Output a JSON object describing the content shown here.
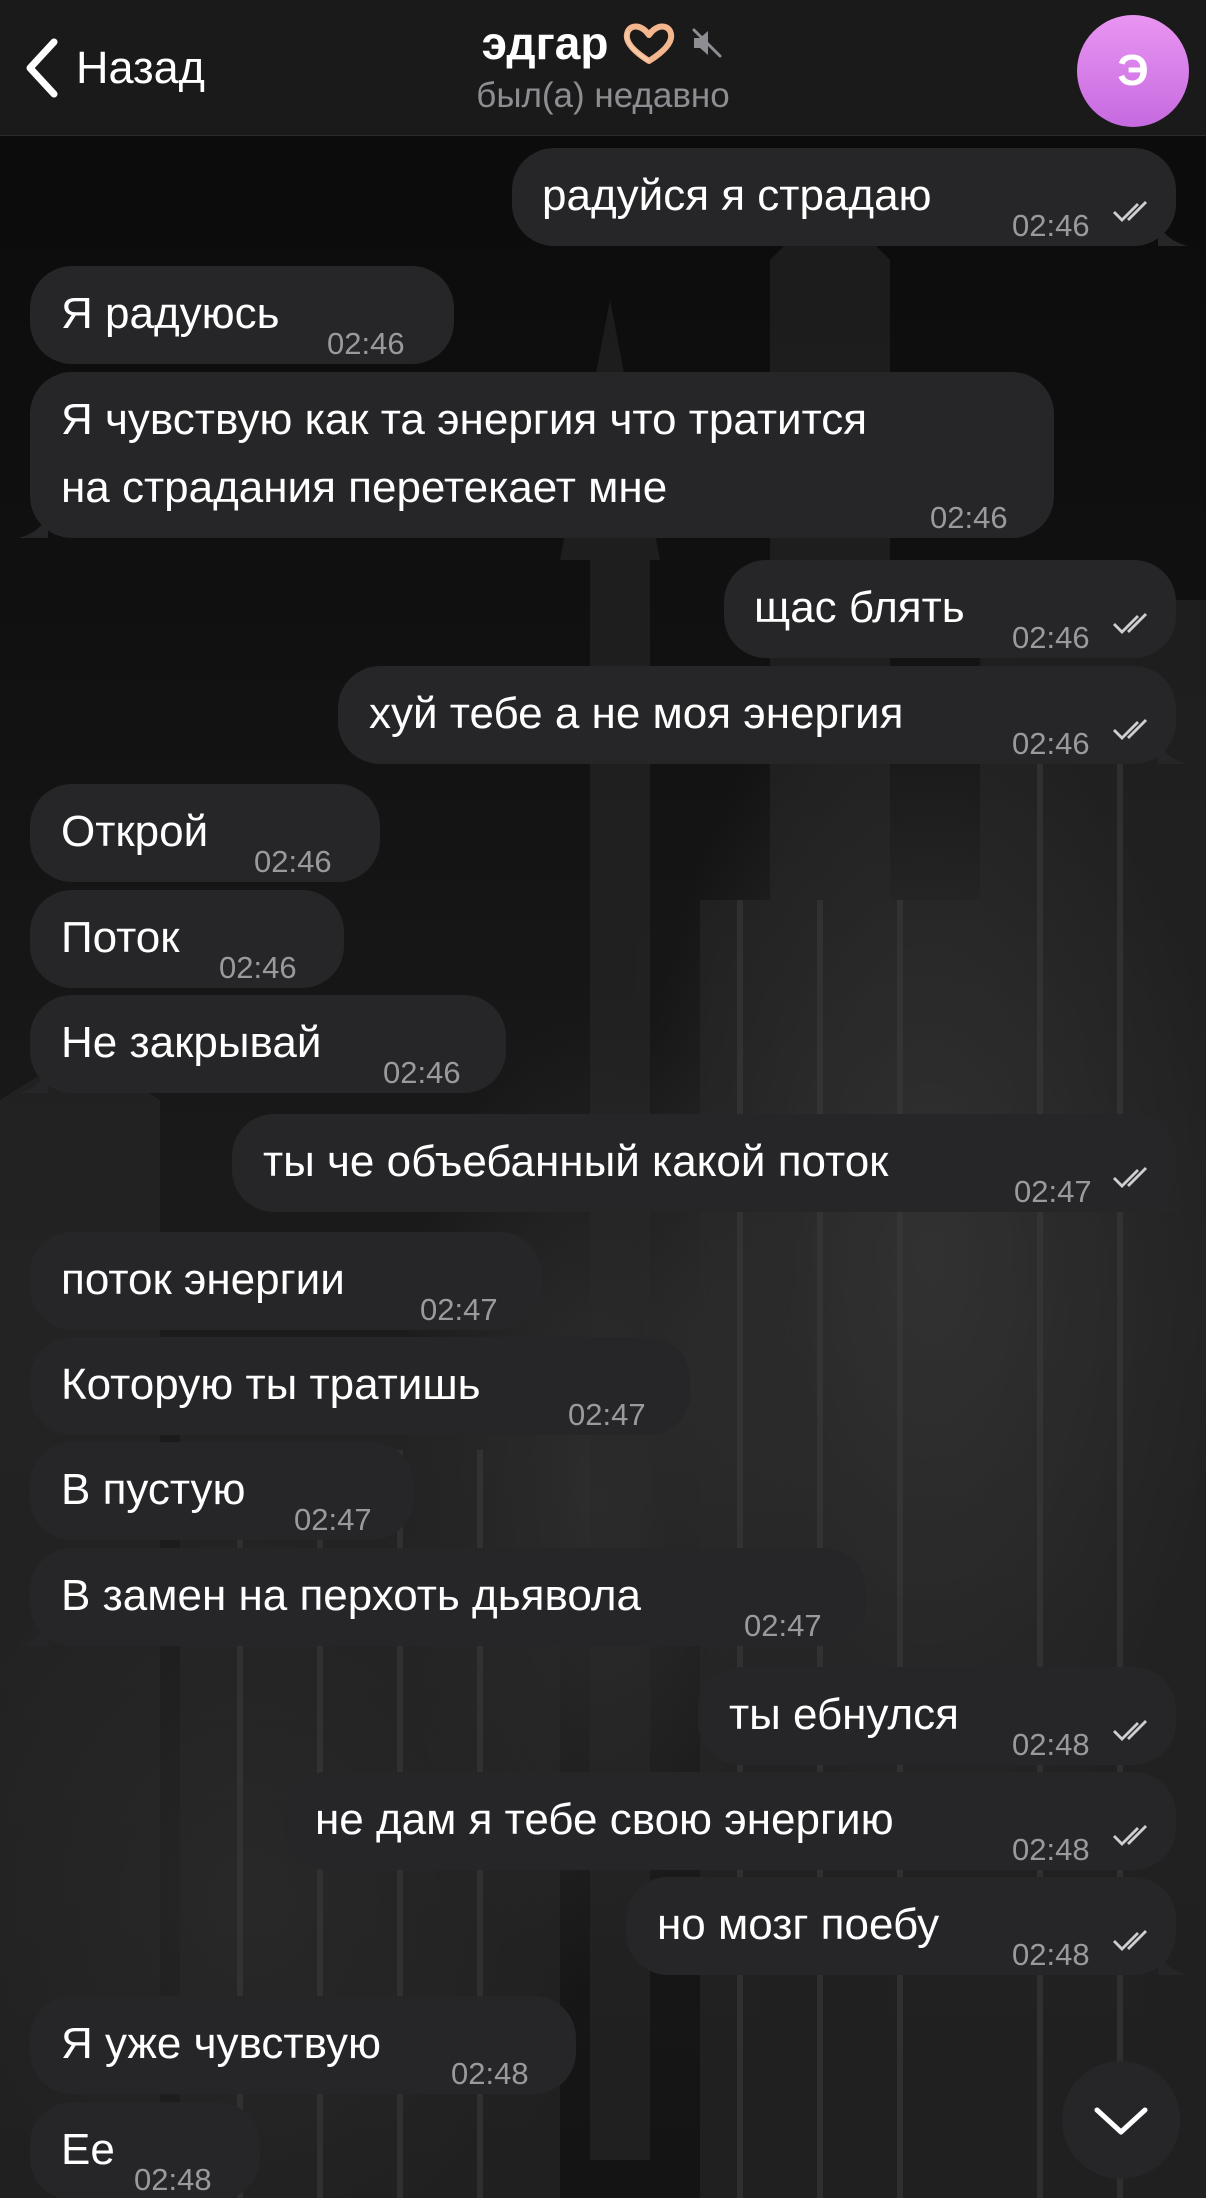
{
  "header": {
    "back_label": "Назад",
    "contact_name": "эдгар",
    "status": "был(а) недавно",
    "avatar_letter": "Э"
  },
  "colors": {
    "header_bg": "#1a1a1a",
    "bubble_bg": "#262628",
    "avatar_gradient": [
      "#e995f2",
      "#c66ae0"
    ],
    "time_text": "#9a9a9e"
  },
  "messages": [
    {
      "dir": "out",
      "text": "радуйся я страдаю",
      "time": "02:46",
      "read": true
    },
    {
      "dir": "in",
      "text": "Я радуюсь",
      "time": "02:46"
    },
    {
      "dir": "in",
      "text": "Я чувствую как та энергия что тратится\nна страдания перетекает мне",
      "line1": "Я чувствую как та энергия что тратится",
      "line2": "на страдания перетекает мне",
      "time": "02:46"
    },
    {
      "dir": "out",
      "text": "щас блять",
      "time": "02:46",
      "read": true
    },
    {
      "dir": "out",
      "text": "хуй тебе а не моя энергия",
      "time": "02:46",
      "read": true
    },
    {
      "dir": "in",
      "text": "Открой",
      "time": "02:46"
    },
    {
      "dir": "in",
      "text": "Поток",
      "time": "02:46"
    },
    {
      "dir": "in",
      "text": "Не закрывай",
      "time": "02:46"
    },
    {
      "dir": "out",
      "text": "ты че объебанный какой поток",
      "time": "02:47",
      "read": true
    },
    {
      "dir": "in",
      "text": "поток энергии",
      "time": "02:47"
    },
    {
      "dir": "in",
      "text": "Которую ты тратишь",
      "time": "02:47"
    },
    {
      "dir": "in",
      "text": "В пустую",
      "time": "02:47"
    },
    {
      "dir": "in",
      "text": "В замен на перхоть дьявола",
      "time": "02:47"
    },
    {
      "dir": "out",
      "text": "ты ебнулся",
      "time": "02:48",
      "read": true
    },
    {
      "dir": "out",
      "text": "не дам я тебе свою энергию",
      "time": "02:48",
      "read": true
    },
    {
      "dir": "out",
      "text": "но мозг поебу",
      "time": "02:48",
      "read": true
    },
    {
      "dir": "in",
      "text": "Я уже чувствую",
      "time": "02:48"
    },
    {
      "dir": "in",
      "text": "Ее",
      "time": "02:48"
    }
  ],
  "icons": {
    "back": "chevron-left-icon",
    "heart_hands": "heart-hands-icon",
    "muted": "muted-speaker-icon",
    "read_receipt": "double-check-icon",
    "scroll_down": "chevron-down-icon"
  }
}
